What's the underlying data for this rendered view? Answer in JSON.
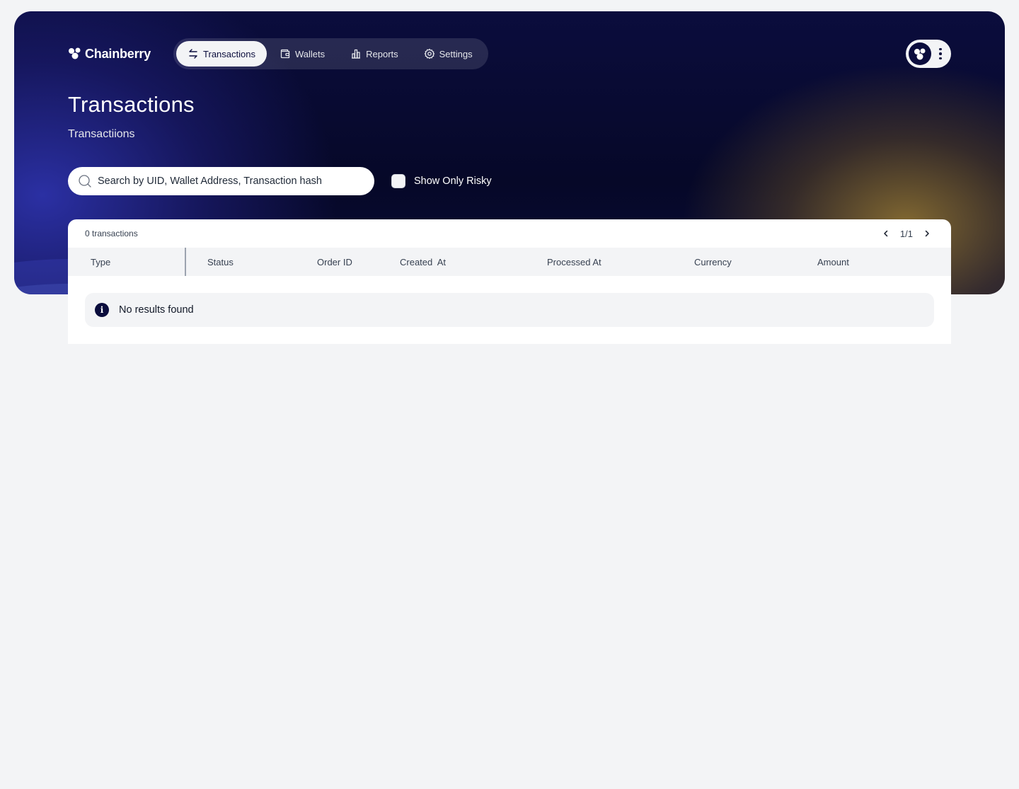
{
  "app": {
    "brand": "Chainberry"
  },
  "nav": {
    "items": [
      {
        "label": "Transactions",
        "icon": "arrows-swap-icon",
        "active": true
      },
      {
        "label": "Wallets",
        "icon": "wallet-icon",
        "active": false
      },
      {
        "label": "Reports",
        "icon": "bar-chart-icon",
        "active": false
      },
      {
        "label": "Settings",
        "icon": "gear-icon",
        "active": false
      }
    ]
  },
  "header": {
    "title": "Transactions",
    "subtitle": "Transactiions"
  },
  "search": {
    "placeholder": "Search by UID, Wallet Address, Transaction hash",
    "value": ""
  },
  "filter": {
    "risky_label": "Show Only Risky",
    "risky_checked": false
  },
  "table": {
    "count_label": "0 transactions",
    "page_label": "1/1",
    "columns": [
      "Type",
      "Status",
      "Order ID",
      "Created  At",
      "Processed At",
      "Currency",
      "Amount"
    ],
    "empty_message": "No results found"
  },
  "colors": {
    "brand_dark": "#0b0d3d",
    "page_bg": "#f3f4f6"
  }
}
